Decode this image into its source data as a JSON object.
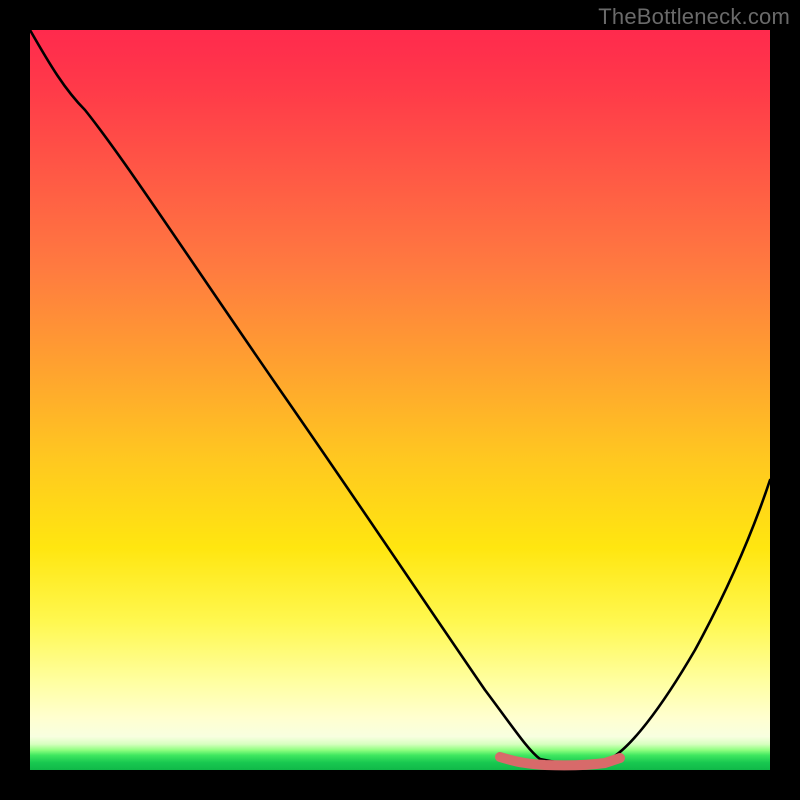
{
  "watermark": "TheBottleneck.com",
  "chart_data": {
    "type": "line",
    "title": "",
    "xlabel": "",
    "ylabel": "",
    "xlim": [
      0,
      100
    ],
    "ylim": [
      0,
      100
    ],
    "grid": false,
    "legend": false,
    "series": [
      {
        "name": "black-curve",
        "color": "#000000",
        "x": [
          0,
          5,
          10,
          20,
          30,
          40,
          50,
          58,
          62,
          66,
          70,
          74,
          78,
          82,
          86,
          90,
          95,
          100
        ],
        "y": [
          100,
          96,
          90,
          77,
          64,
          51,
          38,
          24,
          15,
          8,
          3,
          1,
          1,
          2,
          6,
          14,
          25,
          40
        ]
      },
      {
        "name": "red-floor-segment",
        "color": "#d86a6a",
        "x": [
          62,
          66,
          70,
          74,
          78
        ],
        "y": [
          1.5,
          1.0,
          0.8,
          1.0,
          1.5
        ]
      }
    ],
    "notes": "Values estimated from pixels; chart has no axes or tick labels."
  },
  "colors": {
    "gradient_top": "#ff2a4d",
    "gradient_bottom": "#10b848",
    "curve": "#000000",
    "floor_segment": "#d86a6a",
    "frame": "#000000",
    "watermark": "#6a6a6a"
  }
}
